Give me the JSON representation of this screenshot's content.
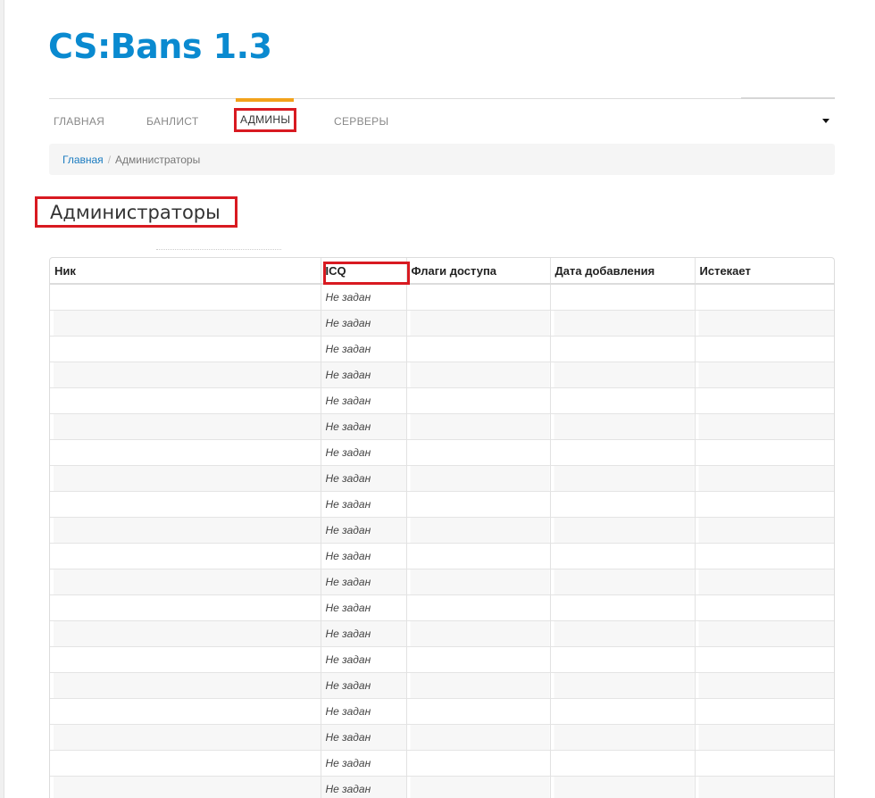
{
  "site": {
    "logo": "CS:Bans 1.3"
  },
  "nav": {
    "items": [
      {
        "label": "ГЛАВНАЯ"
      },
      {
        "label": "БАНЛИСТ"
      },
      {
        "label": "АДМИНЫ"
      },
      {
        "label": "СЕРВЕРЫ"
      }
    ]
  },
  "breadcrumb": {
    "home": "Главная",
    "separator": "/",
    "current": "Администраторы"
  },
  "page": {
    "title": "Администраторы"
  },
  "table": {
    "headers": {
      "nick": "Ник",
      "icq": "ICQ",
      "flags": "Флаги доступа",
      "added": "Дата добавления",
      "expires": "Истекает"
    },
    "rows": [
      {
        "icq": "Не задан"
      },
      {
        "icq": "Не задан"
      },
      {
        "icq": "Не задан"
      },
      {
        "icq": "Не задан"
      },
      {
        "icq": "Не задан"
      },
      {
        "icq": "Не задан"
      },
      {
        "icq": "Не задан"
      },
      {
        "icq": "Не задан"
      },
      {
        "icq": "Не задан"
      },
      {
        "icq": "Не задан"
      },
      {
        "icq": "Не задан"
      },
      {
        "icq": "Не задан"
      },
      {
        "icq": "Не задан"
      },
      {
        "icq": "Не задан"
      },
      {
        "icq": "Не задан"
      },
      {
        "icq": "Не задан"
      },
      {
        "icq": "Не задан"
      },
      {
        "icq": "Не задан"
      },
      {
        "icq": "Не задан"
      },
      {
        "icq": "Не задан"
      }
    ]
  },
  "colors": {
    "brand": "#0a8ad0",
    "highlight": "#d81a21",
    "active_tab": "#f2a21b"
  }
}
